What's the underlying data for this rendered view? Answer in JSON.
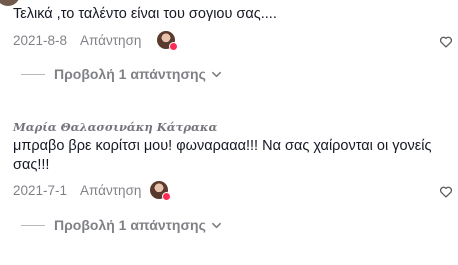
{
  "comments": [
    {
      "username": "",
      "text": "Τελικά ,το ταλέντο είναι του σογιου σας....",
      "date": "2021-8-8",
      "reply_label": "Απάντηση",
      "view_replies_label": "Προβολή 1 απάντησης"
    },
    {
      "username": "Μαρία Θαλασσινάκη Κάτρακα",
      "text": "μπραβο βρε κορίτσι μου! φωναρααα!!! Να σας χαίρονται οι γονείς σας!!!",
      "date": "2021-7-1",
      "reply_label": "Απάντηση",
      "view_replies_label": "Προβολή 1 απάντησης"
    }
  ],
  "icons": {
    "like": "heart-outline-icon",
    "expand": "chevron-down-icon",
    "creator_badge": "creator-badge-icon"
  },
  "colors": {
    "primary_text": "#161823",
    "secondary_text": "#8a8b91",
    "creator_badge": "#fe2c55"
  }
}
